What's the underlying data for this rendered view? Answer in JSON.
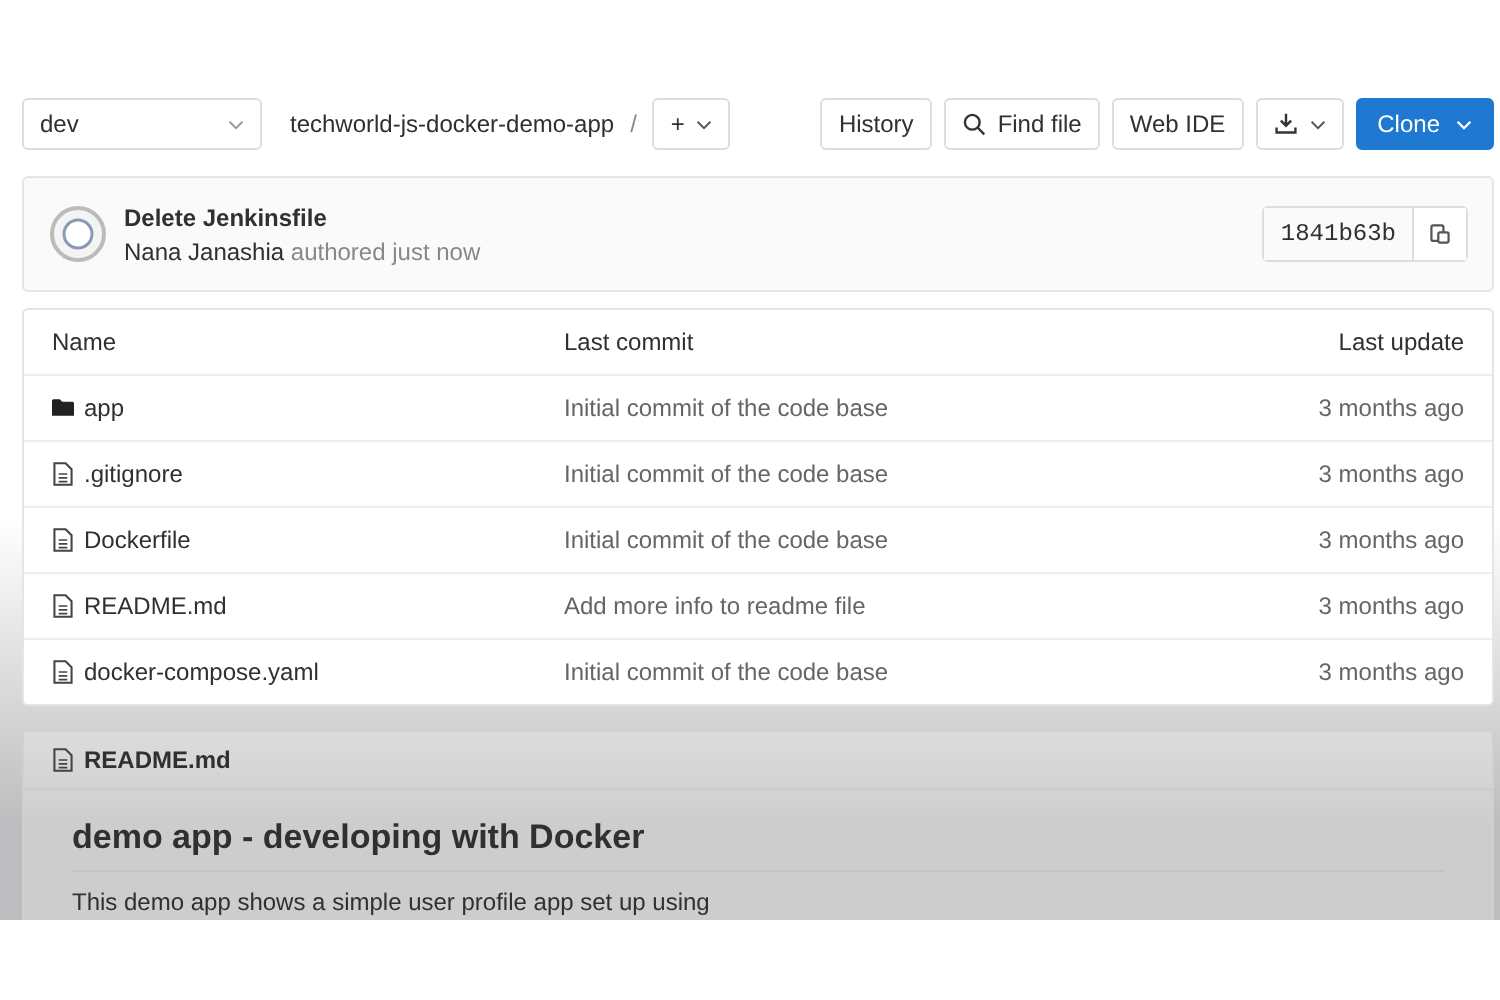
{
  "toolbar": {
    "branch": "dev",
    "repo": "techworld-js-docker-demo-app",
    "separator": "/",
    "add_button": "+",
    "buttons": [
      {
        "kind": "text",
        "label": "History"
      },
      {
        "kind": "search",
        "label": "Find file"
      },
      {
        "kind": "text",
        "label": "Web IDE"
      },
      {
        "kind": "download"
      },
      {
        "kind": "primary",
        "label": "Clone"
      }
    ]
  },
  "commit": {
    "title": "Delete Jenkinsfile",
    "author": "Nana Janashia",
    "meta": "authored just now",
    "sha": "1841b63b"
  },
  "table": {
    "columns": [
      "Name",
      "Last commit",
      "Last update"
    ],
    "rows": [
      {
        "kind": "folder",
        "name": "app",
        "commit": "Initial commit of the code base",
        "updated": "3 months ago"
      },
      {
        "kind": "file",
        "name": ".gitignore",
        "commit": "Initial commit of the code base",
        "updated": "3 months ago"
      },
      {
        "kind": "file",
        "name": "Dockerfile",
        "commit": "Initial commit of the code base",
        "updated": "3 months ago"
      },
      {
        "kind": "file",
        "name": "README.md",
        "commit": "Add more info to readme file",
        "updated": "3 months ago"
      },
      {
        "kind": "file",
        "name": "docker-compose.yaml",
        "commit": "Initial commit of the code base",
        "updated": "3 months ago"
      }
    ]
  },
  "readme": {
    "filename": "README.md",
    "heading": "demo app - developing with Docker",
    "paragraph": "This demo app shows a simple user profile app set up using"
  }
}
